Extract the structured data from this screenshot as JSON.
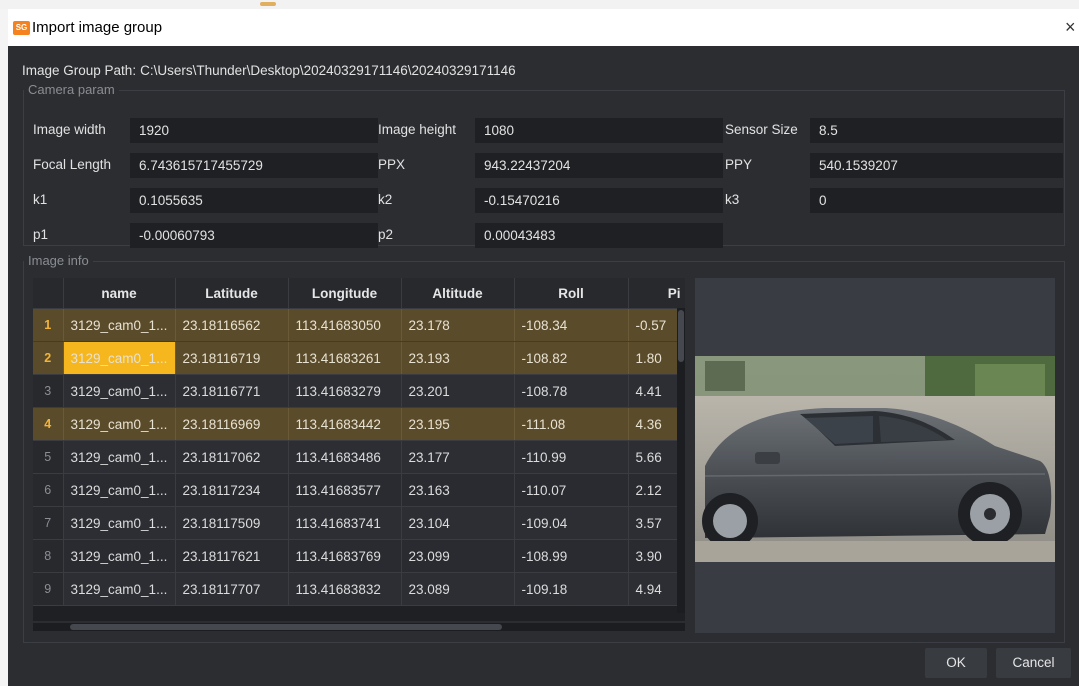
{
  "window": {
    "title": "Import image group",
    "app_icon_text": "SG"
  },
  "path": {
    "label": "Image Group Path:",
    "value": "C:\\Users\\Thunder\\Desktop\\20240329171146\\20240329171146"
  },
  "camera_param": {
    "legend": "Camera param",
    "fields": {
      "image_width": {
        "label": "Image width",
        "value": "1920"
      },
      "image_height": {
        "label": "Image height",
        "value": "1080"
      },
      "sensor_size": {
        "label": "Sensor Size",
        "value": "8.5"
      },
      "focal_length": {
        "label": "Focal Length",
        "value": "6.743615717455729"
      },
      "ppx": {
        "label": "PPX",
        "value": "943.22437204"
      },
      "ppy": {
        "label": "PPY",
        "value": "540.1539207"
      },
      "k1": {
        "label": "k1",
        "value": "0.1055635"
      },
      "k2": {
        "label": "k2",
        "value": "-0.15470216"
      },
      "k3": {
        "label": "k3",
        "value": "0"
      },
      "p1": {
        "label": "p1",
        "value": "-0.00060793"
      },
      "p2": {
        "label": "p2",
        "value": "0.00043483"
      }
    }
  },
  "image_info": {
    "legend": "Image info",
    "columns": [
      "name",
      "Latitude",
      "Longitude",
      "Altitude",
      "Roll",
      "Pi"
    ],
    "rows": [
      {
        "index": "1",
        "name": "3129_cam0_1...",
        "latitude": "23.18116562",
        "longitude": "113.41683050",
        "altitude": "23.178",
        "roll": "-108.34",
        "pitch": "-0.57"
      },
      {
        "index": "2",
        "name": "3129_cam0_1...",
        "latitude": "23.18116719",
        "longitude": "113.41683261",
        "altitude": "23.193",
        "roll": "-108.82",
        "pitch": "1.80"
      },
      {
        "index": "3",
        "name": "3129_cam0_1...",
        "latitude": "23.18116771",
        "longitude": "113.41683279",
        "altitude": "23.201",
        "roll": "-108.78",
        "pitch": "4.41"
      },
      {
        "index": "4",
        "name": "3129_cam0_1...",
        "latitude": "23.18116969",
        "longitude": "113.41683442",
        "altitude": "23.195",
        "roll": "-111.08",
        "pitch": "4.36"
      },
      {
        "index": "5",
        "name": "3129_cam0_1...",
        "latitude": "23.18117062",
        "longitude": "113.41683486",
        "altitude": "23.177",
        "roll": "-110.99",
        "pitch": "5.66"
      },
      {
        "index": "6",
        "name": "3129_cam0_1...",
        "latitude": "23.18117234",
        "longitude": "113.41683577",
        "altitude": "23.163",
        "roll": "-110.07",
        "pitch": "2.12"
      },
      {
        "index": "7",
        "name": "3129_cam0_1...",
        "latitude": "23.18117509",
        "longitude": "113.41683741",
        "altitude": "23.104",
        "roll": "-109.04",
        "pitch": "3.57"
      },
      {
        "index": "8",
        "name": "3129_cam0_1...",
        "latitude": "23.18117621",
        "longitude": "113.41683769",
        "altitude": "23.099",
        "roll": "-108.99",
        "pitch": "3.90"
      },
      {
        "index": "9",
        "name": "3129_cam0_1...",
        "latitude": "23.18117707",
        "longitude": "113.41683832",
        "altitude": "23.089",
        "roll": "-109.18",
        "pitch": "4.94"
      }
    ],
    "selected_rows": [
      1,
      2,
      4
    ],
    "current_cell_row": 2
  },
  "buttons": {
    "ok": "OK",
    "cancel": "Cancel"
  },
  "icons": {
    "app": "app-logo-icon",
    "close": "close-icon"
  },
  "colors": {
    "selection_row": "#5a4b2b",
    "current_cell": "#f5b61e",
    "selected_index": "#f2b53a",
    "app_icon": "#f5821f"
  }
}
